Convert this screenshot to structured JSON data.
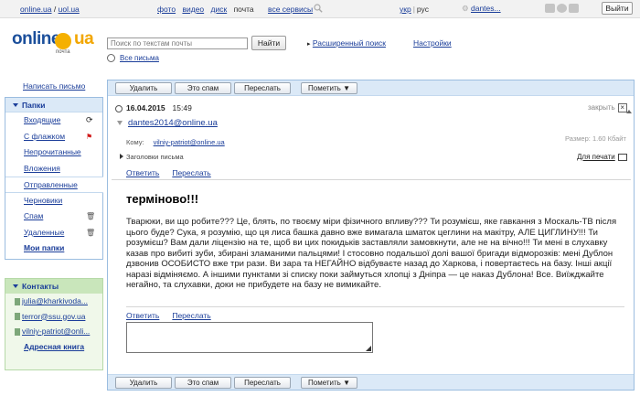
{
  "topbar": {
    "home": "online.ua",
    "slash": " / ",
    "uol": "uol.ua",
    "services": [
      {
        "label": "фото",
        "link": true
      },
      {
        "label": "видео",
        "link": true
      },
      {
        "label": "диск",
        "link": true
      },
      {
        "label": "почта",
        "link": false
      },
      {
        "label": "все сервисы",
        "link": true
      }
    ],
    "lang_ukr": "укр",
    "lang_sep": "|",
    "lang_rus": "рус",
    "user": "dantes...",
    "exit": "Выйти"
  },
  "header": {
    "logo_main": "online",
    "logo_tld": "ua",
    "logo_sub": "почта",
    "search_placeholder": "Поиск по текстам почты",
    "search_button": "Найти",
    "advanced_search": "Расширенный поиск",
    "settings": "Настройки",
    "all_mail": "Все письма"
  },
  "sidebar": {
    "compose": "Написать письмо",
    "folders_title": "Папки",
    "folders": [
      {
        "label": "Входящие",
        "icon": "refresh-icon"
      },
      {
        "label": "С флажком",
        "icon": "flag-icon"
      },
      {
        "label": "Непрочитанные",
        "icon": ""
      },
      {
        "label": "Вложения",
        "icon": ""
      },
      {
        "label": "Отправленные",
        "icon": ""
      },
      {
        "label": "Черновики",
        "icon": ""
      },
      {
        "label": "Спам",
        "icon": "trash-icon"
      },
      {
        "label": "Удаленные",
        "icon": "trash-icon"
      },
      {
        "label": "Мои папки",
        "icon": ""
      }
    ],
    "contacts_title": "Контакты",
    "contacts": [
      "julia@kharkivoda...",
      "terror@ssu.gov.ua",
      "vilniy-patriot@onli..."
    ],
    "address_book": "Адресная книга"
  },
  "toolbar": {
    "delete": "Удалить",
    "spam": "Это спам",
    "forward": "Переслать",
    "mark": "Пометить ▼"
  },
  "message": {
    "date": "16.04.2015",
    "time": "15:49",
    "close": "закрыть",
    "from": "dantes2014@online.ua",
    "to_label": "Кому:",
    "to": "vilniy-patriot@online.ua",
    "size": "Размер: 1.60 Кбайт",
    "headers": "Заголовки письма",
    "print": "Для печати",
    "reply": "Ответить",
    "forward": "Переслать",
    "subject": "терміново!!!",
    "body": "Тварюки, ви що робите??? Це, блять, по твоєму міри фізичного впливу??? Ти розумієш, яке гавкання з Москаль-ТВ після цього буде? Сука, я розумію, що ця лиса башка давно вже вимагала шматок цеглини на макітру, АЛЕ ЦИГЛИНУ!!! Ти розумієш? Вам дали ліцензію на те, щоб ви цих покидьків заставляли замовкнути, але не на вічно!!! Ти мені в слухавку казав про вибиті зуби, збирані зламаними пальцями! І стосовно подальшої долі вашої бригади відморозків: мені Дублон дзвонив ОСОБИСТО вже три рази. Ви зара та НЕГАЙНО відбуваєте назад до Харкова, і повертаєтесь на базу. Інші акції наразі відміняємо. А іншими пунктами зі списку поки займуться хлопці з Дніпра — це наказ Дублона! Все. Виїжджайте негайно, та слухавки, доки не прибудете на базу не вимикайте."
  },
  "colors": {
    "link": "#1a3d99",
    "panel_blue": "#dbe9f7",
    "panel_green": "#f0f8ea",
    "logo_blue": "#1b4f9b",
    "logo_orange": "#f5b000"
  }
}
